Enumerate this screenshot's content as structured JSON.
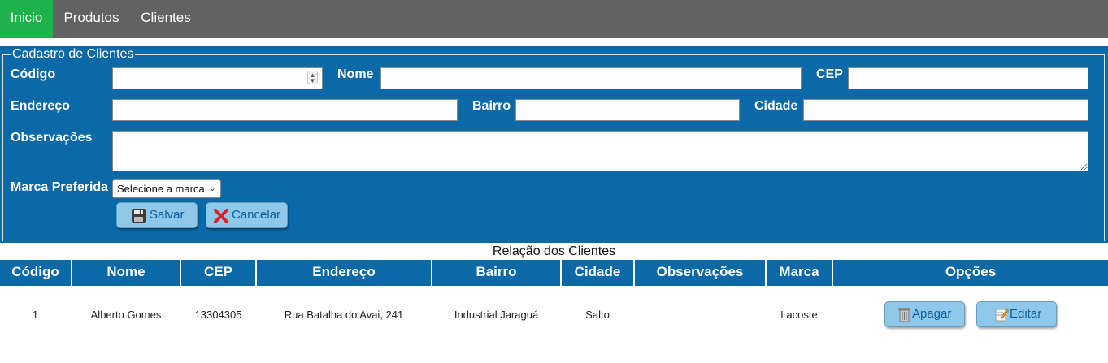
{
  "nav": {
    "items": [
      {
        "label": "Inicio"
      },
      {
        "label": "Produtos"
      },
      {
        "label": "Clientes"
      }
    ]
  },
  "form": {
    "legend": "Cadastro de Clientes",
    "fields": {
      "codigo": {
        "label": "Código",
        "value": ""
      },
      "nome": {
        "label": "Nome",
        "value": ""
      },
      "cep": {
        "label": "CEP",
        "value": ""
      },
      "endereco": {
        "label": "Endereço",
        "value": ""
      },
      "bairro": {
        "label": "Bairro",
        "value": ""
      },
      "cidade": {
        "label": "Cidade",
        "value": ""
      },
      "observacoes": {
        "label": "Observações",
        "value": ""
      },
      "marca": {
        "label": "Marca Preferida",
        "selected": "Selecione a marca"
      }
    },
    "buttons": {
      "save": "Salvar",
      "cancel": "Cancelar"
    }
  },
  "table": {
    "caption": "Relação dos Clientes",
    "headers": [
      "Código",
      "Nome",
      "CEP",
      "Endereço",
      "Bairro",
      "Cidade",
      "Observações",
      "Marca",
      "Opções"
    ],
    "rows": [
      {
        "codigo": "1",
        "nome": "Alberto Gomes",
        "cep": "13304305",
        "endereco": "Rua Batalha do Avai, 241",
        "bairro": "Industrial Jaraguá",
        "cidade": "Salto",
        "observacoes": "",
        "marca": "Lacoste",
        "delete_label": "Apagar",
        "edit_label": "Editar"
      }
    ]
  },
  "colors": {
    "nav_bg": "#626262",
    "nav_active": "#1fb24a",
    "panel_bg": "#0b69a8",
    "button_bg": "#8ec8eb"
  }
}
